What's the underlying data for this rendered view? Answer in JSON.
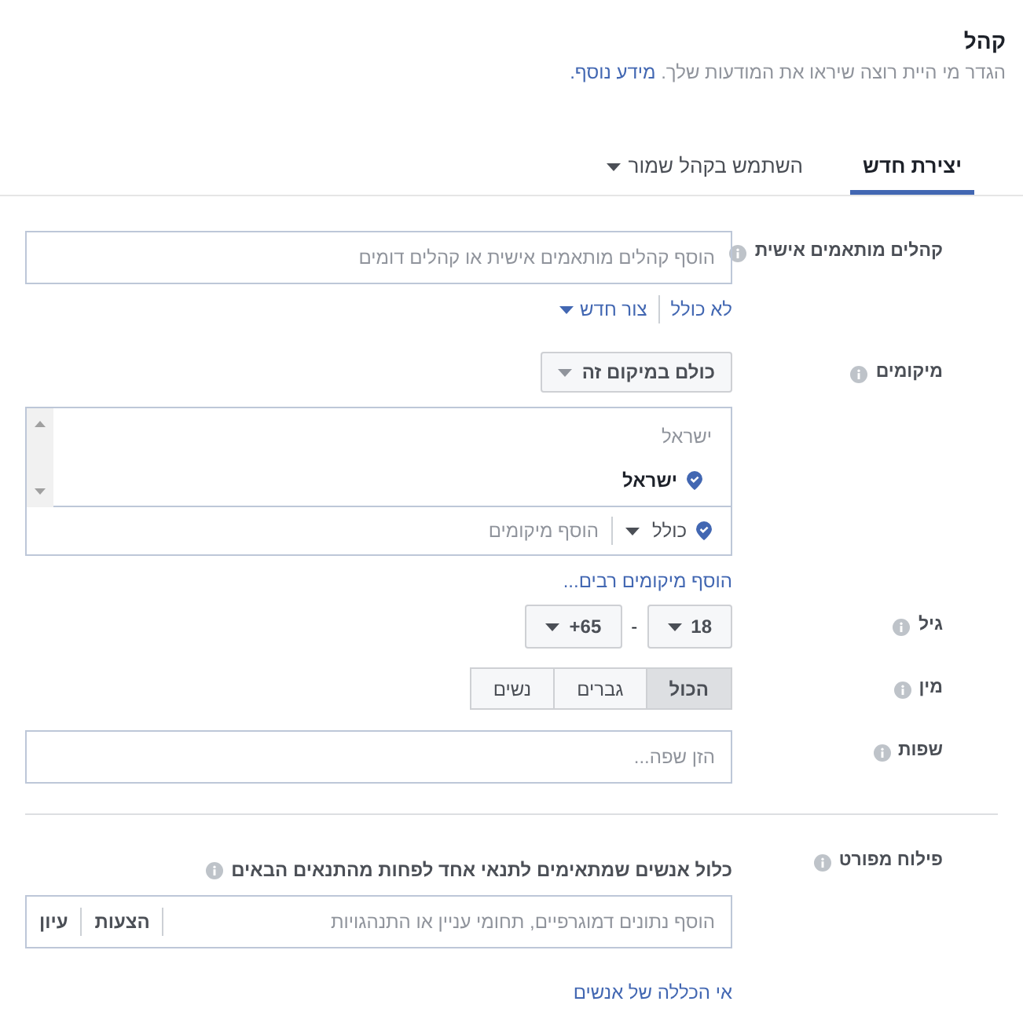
{
  "header": {
    "title": "קהל",
    "description": "הגדר מי היית רוצה שיראו את המודעות שלך.",
    "link": "מידע נוסף."
  },
  "tabs": [
    {
      "label": "יצירת חדש",
      "selected": true,
      "kind": "plain"
    },
    {
      "label": "השתמש בקהל שמור",
      "selected": false,
      "kind": "dropdown"
    }
  ],
  "custom_audiences": {
    "label": "קהלים מותאמים אישית",
    "placeholder": "הוסף קהלים מותאמים אישית או קהלים דומים",
    "links": [
      "לא כולל",
      "צור חדש"
    ]
  },
  "locations": {
    "label": "מיקומים",
    "dropdown": "כולם במיקום זה",
    "list_header": "ישראל",
    "items": [
      {
        "name": "ישראל"
      }
    ],
    "include": "כולל",
    "placeholder": "הוסף מיקומים",
    "bulk_link": "הוסף מיקומים רבים..."
  },
  "age": {
    "label": "גיל",
    "from": "18",
    "separator": "-",
    "to": "+65"
  },
  "gender": {
    "label": "מין",
    "options": [
      {
        "label": "הכול",
        "selected": true
      },
      {
        "label": "גברים",
        "selected": false
      },
      {
        "label": "נשים",
        "selected": false
      }
    ]
  },
  "languages": {
    "label": "שפות",
    "placeholder": "הזן שפה..."
  },
  "detailed_targeting": {
    "label": "פילוח מפורט",
    "instruction": "כלול אנשים שמתאימים לתנאי אחד לפחות מהתנאים הבאים",
    "placeholder": "הוסף נתונים דמוגרפיים, תחומי עניין או התנהגויות",
    "actions": [
      "הצעות",
      "עיון"
    ],
    "exclude_link": "אי הכללה של אנשים"
  }
}
